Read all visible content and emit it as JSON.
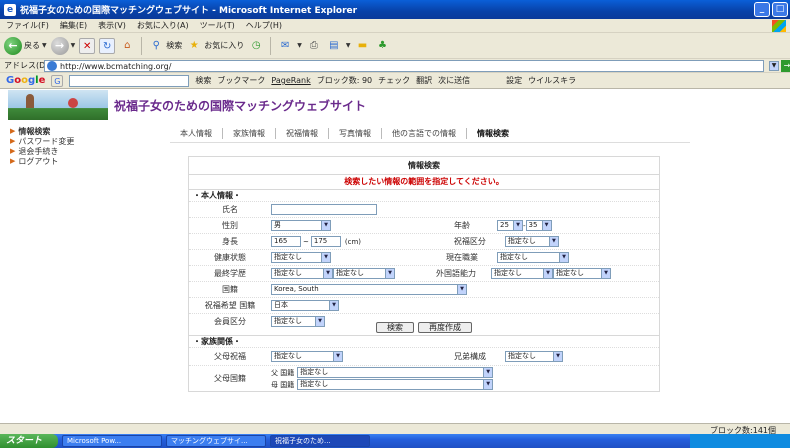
{
  "window": {
    "title": "祝福子女のための国際マッチングウェブサイト - Microsoft Internet Explorer",
    "min": "_",
    "max": "□"
  },
  "menu": [
    "ファイル(F)",
    "編集(E)",
    "表示(V)",
    "お気に入り(A)",
    "ツール(T)",
    "ヘルプ(H)"
  ],
  "toolbar": {
    "back": "戻る",
    "search": "検索",
    "favorites": "お気に入り"
  },
  "address": {
    "label": "アドレス(D)",
    "url": "http://www.bcmatching.org/"
  },
  "google": {
    "logo": "Google",
    "search": "検索",
    "bookmarks": "ブックマーク",
    "pagerank": "PageRank",
    "blocked": "ブロック数: 90",
    "check": "チェック",
    "translate": "翻訳",
    "send": "次に送信",
    "settings": "設定",
    "virus": "ウイルスキラ"
  },
  "page": {
    "site_title": "祝福子女のための国際マッチングウェブサイト",
    "sidebar": [
      "情報検索",
      "パスワード変更",
      "退会手続き",
      "ログアウト"
    ],
    "tabs": [
      "本人情報",
      "家族情報",
      "祝福情報",
      "写真情報",
      "他の言語での情報",
      "情報検索"
    ],
    "form": {
      "title": "情報検索",
      "subtitle": "検索したい情報の範囲を指定してください。",
      "section_personal": "本人情報",
      "name_label": "氏名",
      "gender_label": "性別",
      "gender_value": "男",
      "age_label": "年齢",
      "age_from": "25",
      "age_to": "35",
      "height_label": "身長",
      "height_from": "165",
      "height_to": "175",
      "height_unit": "(cm)",
      "blessing_type_label": "祝福区分",
      "none": "指定なし",
      "health_label": "健康状態",
      "job_label": "現在職業",
      "edu_label": "最終学歴",
      "lang_label": "外国語能力",
      "nationality_label": "国籍",
      "nationality_value": "Korea, South",
      "desired_nat_label": "祝福希望 国籍",
      "desired_nat_value": "日本",
      "member_label": "会員区分",
      "section_family": "家族関係",
      "parents_blessed_label": "父母祝福",
      "siblings_label": "兄弟構成",
      "parents_nat_label": "父母国籍",
      "father_prefix": "父 国籍",
      "mother_prefix": "母 国籍",
      "search_button": "検索",
      "reset_button": "再度作成"
    }
  },
  "status": {
    "blocked": "ブロック数:141個"
  },
  "taskbar": {
    "start": "スタート",
    "tasks": [
      "Microsoft Pow...",
      "マッチングウェブサイ...",
      "祝福子女のため..."
    ]
  }
}
